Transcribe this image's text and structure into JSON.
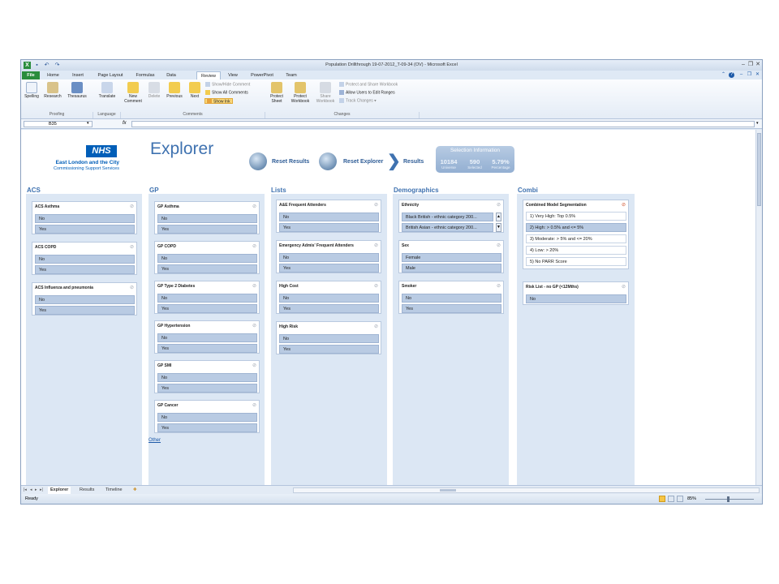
{
  "window": {
    "title": "Population Drillthrough 19-07-2012_T-09-34 (OV) - Microsoft Excel",
    "qat_icons": [
      "excel-icon",
      "save-icon",
      "undo-icon",
      "redo-icon"
    ]
  },
  "ribbon_tabs": [
    "File",
    "Home",
    "Insert",
    "Page Layout",
    "Formulas",
    "Data",
    "Review",
    "View",
    "PowerPivot",
    "Team"
  ],
  "ribbon": {
    "proofing": {
      "group": "Proofing",
      "spelling": "Spelling",
      "research": "Research",
      "thesaurus": "Thesaurus"
    },
    "language": {
      "group": "Language",
      "translate": "Translate"
    },
    "comments": {
      "group": "Comments",
      "new_comment_1": "New",
      "new_comment_2": "Comment",
      "delete": "Delete",
      "previous": "Previous",
      "next": "Next",
      "show_hide": "Show/Hide Comment",
      "show_all": "Show All Comments",
      "show_ink": "Show Ink"
    },
    "changes": {
      "group": "Changes",
      "protect_sheet_1": "Protect",
      "protect_sheet_2": "Sheet",
      "protect_workbook_1": "Protect",
      "protect_workbook_2": "Workbook",
      "share_workbook_1": "Share",
      "share_workbook_2": "Workbook",
      "protect_share": "Protect and Share Workbook",
      "allow_edit": "Allow Users to Edit Ranges",
      "track_changes": "Track Changes ▾"
    }
  },
  "formula_bar": {
    "name_box": "B35",
    "fx": "fx",
    "formula": ""
  },
  "dashboard": {
    "title": "Explorer",
    "nhs_logo": "NHS",
    "org_name": "East London and the City",
    "org_sub": "Commissioning Support Services",
    "reset_results": "Reset Results",
    "reset_explorer": "Reset Explorer",
    "results": "Results",
    "selection": {
      "title": "Selection Information",
      "universe_value": "10184",
      "universe_label": "Universe",
      "selected_value": "590",
      "selected_label": "Selected",
      "percentage_value": "5.79%",
      "percentage_label": "Percentage"
    },
    "columns": {
      "acs": {
        "header": "ACS",
        "cards": [
          {
            "title": "ACS Asthma",
            "items": [
              "No",
              "Yes"
            ]
          },
          {
            "title": "ACS COPD",
            "items": [
              "No",
              "Yes"
            ]
          },
          {
            "title": "ACS Influenza and pneumonia",
            "items": [
              "No",
              "Yes"
            ]
          }
        ]
      },
      "gp": {
        "header": "GP",
        "cards": [
          {
            "title": "GP Asthma",
            "items": [
              "No",
              "Yes"
            ]
          },
          {
            "title": "GP COPD",
            "items": [
              "No",
              "Yes"
            ]
          },
          {
            "title": "GP Type 2 Diabetes",
            "items": [
              "No",
              "Yes"
            ]
          },
          {
            "title": "GP Hypertension",
            "items": [
              "No",
              "Yes"
            ]
          },
          {
            "title": "GP SMI",
            "items": [
              "No",
              "Yes"
            ]
          },
          {
            "title": "GP Cancer",
            "items": [
              "No",
              "Yes"
            ]
          }
        ],
        "other_link": "Other"
      },
      "lists": {
        "header": "Lists",
        "cards": [
          {
            "title": "A&E Frequent Attenders",
            "items": [
              "No",
              "Yes"
            ]
          },
          {
            "title": "Emergency Admis' Frequent Attenders",
            "items": [
              "No",
              "Yes"
            ]
          },
          {
            "title": "High Cost",
            "items": [
              "No",
              "Yes"
            ]
          },
          {
            "title": "High Risk",
            "items": [
              "No",
              "Yes"
            ]
          }
        ]
      },
      "demographics": {
        "header": "Demographics",
        "cards": [
          {
            "title": "Ethnicity",
            "items": [
              "Black British - ethnic category 200...",
              "British Asian - ethnic category 200..."
            ]
          },
          {
            "title": "Sex",
            "items": [
              "Female",
              "Male"
            ]
          },
          {
            "title": "Smoker",
            "items": [
              "No",
              "Yes"
            ]
          }
        ]
      },
      "combi": {
        "header": "Combi",
        "cards": [
          {
            "title": "Combined Model Segmentation",
            "items": [
              "1) Very High: Top 0.5%",
              "2) High: > 0.5% and <= 5%",
              "3) Moderate: > 5% and <= 20%",
              "4) Low: > 20%",
              "5) No PARR Score"
            ]
          },
          {
            "title": "Risk List - no GP (<12Mths)",
            "items": [
              "No"
            ]
          }
        ]
      }
    }
  },
  "sheet_tabs": [
    "Explorer",
    "Results",
    "Timeline"
  ],
  "status": {
    "ready": "Ready",
    "zoom": "85%"
  },
  "colors": {
    "accent": "#3f72b0",
    "nhs_blue": "#005eb8",
    "file_tab": "#2a8d3d",
    "slicer_item": "#b9cbe3",
    "panel_bg": "#dce7f4"
  }
}
